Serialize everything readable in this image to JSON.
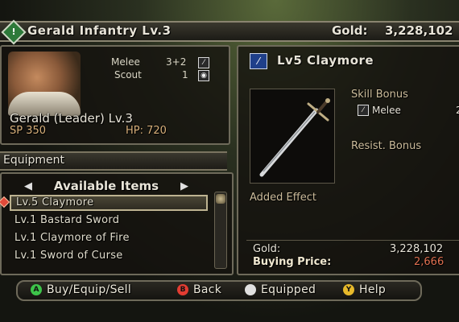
{
  "header": {
    "title": "Gerald Infantry Lv.3",
    "gold_label": "Gold:",
    "gold_value": "3,228,102"
  },
  "unit": {
    "melee_label": "Melee",
    "melee_value": "3+2",
    "scout_label": "Scout",
    "scout_value": "1",
    "leader_name": "Gerald (Leader) Lv.3",
    "sp": "SP 350",
    "hp": "HP: 720"
  },
  "equipment": {
    "title": "Equipment"
  },
  "available_items": {
    "title": "Available Items",
    "items": [
      {
        "label": "Lv.5 Claymore",
        "selected": true
      },
      {
        "label": "Lv.1 Bastard Sword",
        "selected": false
      },
      {
        "label": "Lv.1 Claymore of Fire",
        "selected": false
      },
      {
        "label": "Lv.1 Sword of Curse",
        "selected": false
      }
    ]
  },
  "detail": {
    "weapon_name": "Lv5 Claymore",
    "skill_bonus": "Skill Bonus",
    "melee_label": "Melee",
    "melee_value": "2",
    "resist_bonus": "Resist. Bonus",
    "added_effect": "Added Effect",
    "gold_label": "Gold:",
    "gold_value": "3,228,102",
    "price_label": "Buying Price:",
    "price_value": "2,666"
  },
  "controls": {
    "a_glyph": "A",
    "a_label": "Buy/Equip/Sell",
    "b_glyph": "B",
    "b_label": "Back",
    "equipped_label": "Equipped",
    "y_glyph": "Y",
    "y_label": "Help"
  }
}
